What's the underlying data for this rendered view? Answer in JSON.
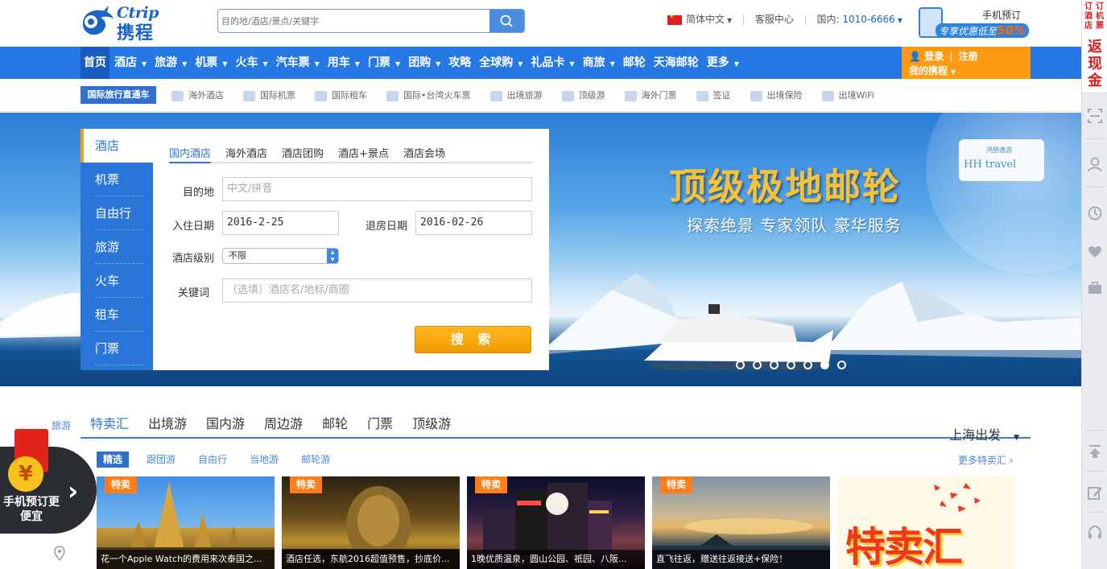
{
  "header": {
    "logo_en": "Ctrip",
    "logo_cn": "携程",
    "search_placeholder": "目的地/酒店/景点/关键字",
    "language": "简体中文",
    "service": "客服中心",
    "phone_label": "国内:",
    "phone": "1010-6666",
    "mobile_title": "手机预订",
    "mobile_promo": "专享优惠低至",
    "mobile_promo_pct": "50%"
  },
  "nav": {
    "items": [
      {
        "label": "首页",
        "arrow": false
      },
      {
        "label": "酒店",
        "arrow": true
      },
      {
        "label": "旅游",
        "arrow": true
      },
      {
        "label": "机票",
        "arrow": true
      },
      {
        "label": "火车",
        "arrow": true
      },
      {
        "label": "汽车票",
        "arrow": true
      },
      {
        "label": "用车",
        "arrow": true
      },
      {
        "label": "门票",
        "arrow": true
      },
      {
        "label": "团购",
        "arrow": true
      },
      {
        "label": "攻略",
        "arrow": false
      },
      {
        "label": "全球购",
        "arrow": true
      },
      {
        "label": "礼品卡",
        "arrow": true
      },
      {
        "label": "商旅",
        "arrow": true
      },
      {
        "label": "邮轮",
        "arrow": false
      },
      {
        "label": "天海邮轮",
        "arrow": false
      },
      {
        "label": "更多",
        "arrow": true
      }
    ],
    "login": "登录",
    "register": "注册",
    "my_ctrip": "我的携程"
  },
  "subnav": {
    "badge": "国际旅行直通车",
    "items": [
      "海外酒店",
      "国际机票",
      "国际租车",
      "国际•台湾火车票",
      "出境旅游",
      "顶级游",
      "海外门票",
      "签证",
      "出境保险",
      "出境WiFi"
    ]
  },
  "banner": {
    "title": "顶级极地邮轮",
    "subtitle": "探索绝景 专家领队 豪华服务",
    "brand_small": "鸿鹄逸游",
    "brand": "HH travel",
    "slides": 7,
    "active_slide": 6
  },
  "search_panel": {
    "side_tabs": [
      "酒店",
      "机票",
      "自由行",
      "旅游",
      "火车",
      "租车",
      "门票"
    ],
    "active_side_tab": 0,
    "tabs": [
      "国内酒店",
      "海外酒店",
      "酒店团购",
      "酒店+景点",
      "酒店会场"
    ],
    "destination_label": "目的地",
    "destination_placeholder": "中文/拼音",
    "checkin_label": "入住日期",
    "checkin_value": "2016-2-25",
    "checkout_label": "退房日期",
    "checkout_value": "2016-02-26",
    "level_label": "酒店级别",
    "level_value": "不限",
    "keyword_label": "关键词",
    "keyword_placeholder": "（选填）酒店名/地标/商圈",
    "search_button": "搜 索"
  },
  "section": {
    "side_label": "旅游",
    "tabs": [
      "特卖汇",
      "出境游",
      "国内游",
      "周边游",
      "邮轮",
      "门票",
      "顶级游"
    ],
    "departure": "上海出发",
    "sub_tabs": [
      "精选",
      "跟团游",
      "自由行",
      "当地游",
      "邮轮游"
    ],
    "more": "更多特卖汇",
    "cards": [
      {
        "tag": "特卖",
        "caption": "花一个Apple Watch的费用来次泰国之..."
      },
      {
        "tag": "特卖",
        "caption": "酒店任选，东航2016超值预售，抄底价..."
      },
      {
        "tag": "特卖",
        "caption": "1晚优质温泉，圆山公园、祇园、八阪..."
      },
      {
        "tag": "特卖",
        "caption": "直飞往返，赠送往返接送+保险！"
      }
    ],
    "promo_banner": "特卖汇"
  },
  "float_badge": {
    "text": "手机预订更便宜",
    "yen": "¥"
  },
  "right_bar": {
    "promo_col1": "订酒店",
    "promo_col2": "订机票",
    "promo_big": "返现金"
  }
}
